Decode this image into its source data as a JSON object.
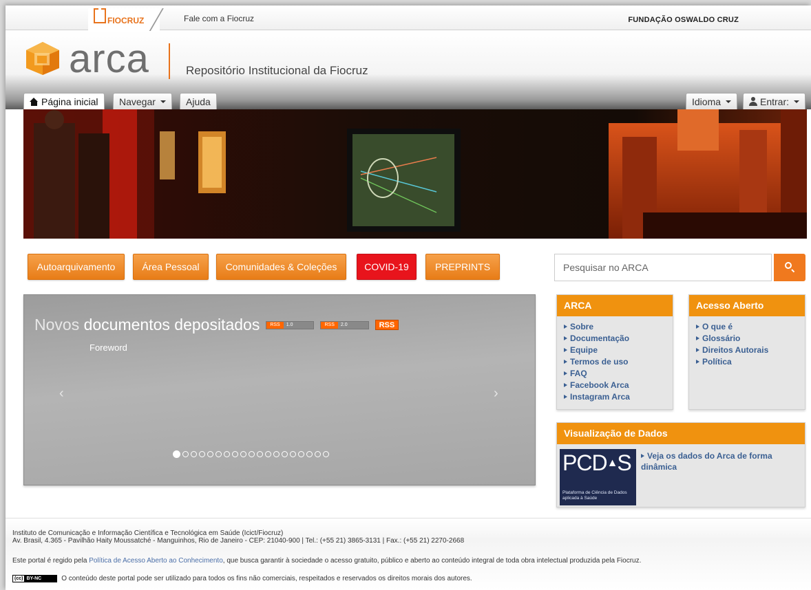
{
  "topbar": {
    "fiocruz_logo": "FIOCRUZ",
    "fale_link": "Fale com a Fiocruz",
    "fundacao": "FUNDAÇÃO OSWALDO CRUZ"
  },
  "header": {
    "logo_word": "arca",
    "repo_title": "Repositório Institucional da Fiocruz"
  },
  "nav": {
    "home": "Página inicial",
    "navegar": "Navegar",
    "ajuda": "Ajuda",
    "idioma": "Idioma",
    "entrar": "Entrar:"
  },
  "actions": {
    "autoarquivamento": "Autoarquivamento",
    "area_pessoal": "Área Pessoal",
    "comunidades": "Comunidades & Coleções",
    "covid": "COVID-19",
    "preprints": "PREPRINTS"
  },
  "search": {
    "placeholder": "Pesquisar no ARCA"
  },
  "carousel": {
    "title_light": "Novos",
    "title_main": "documentos depositados",
    "rss1_left": "RSS",
    "rss1_right": "1.0",
    "rss2_left": "RSS",
    "rss2_right": "2.0",
    "rss3": "RSS",
    "item_title": "Foreword",
    "prev": "‹",
    "next": "›",
    "slide_count": 19,
    "active_slide": 0
  },
  "panel_arca": {
    "title": "ARCA",
    "items": [
      "Sobre",
      "Documentação",
      "Equipe",
      "Termos de uso",
      "FAQ",
      "Facebook Arca",
      "Instagram Arca"
    ]
  },
  "panel_acesso": {
    "title": "Acesso Aberto",
    "items": [
      "O que é",
      "Glossário",
      "Direitos Autorais",
      "Política"
    ]
  },
  "panel_dados": {
    "title": "Visualização de Dados",
    "logo_big": "PCD",
    "logo_big_s": "S",
    "logo_small": "Plataforma de Ciência de Dados aplicada à Saúde",
    "link": "Veja os dados do Arca de forma dinâmica"
  },
  "footer": {
    "line1a": "Instituto de Comunicação e Informação Científica e Tecnológica em Saúde (Icict/Fiocruz)",
    "line1b": "Av. Brasil, 4.365 - Pavilhão Haity Moussatché - Manguinhos, Rio de Janeiro - CEP: 21040-900 | Tel.: (+55 21) 3865-3131 | Fax.: (+55 21) 2270-2668",
    "line2a": "Este portal é regido pela ",
    "line2_link": "Política de Acesso Aberto ao Conhecimento",
    "line2b": ", que busca garantir à sociedade o acesso gratuito, público e aberto ao conteúdo integral de toda obra intelectual produzida pela Fiocruz.",
    "cc_a": "(cc)",
    "cc_b": "BY-NC",
    "line3": "O conteúdo deste portal pode ser utilizado para todos os fins não comerciais, respeitados e reservados os direitos morais dos autores."
  },
  "colors": {
    "orange": "#f0791e",
    "red": "#e8141c",
    "link_blue": "#3a5f92"
  }
}
